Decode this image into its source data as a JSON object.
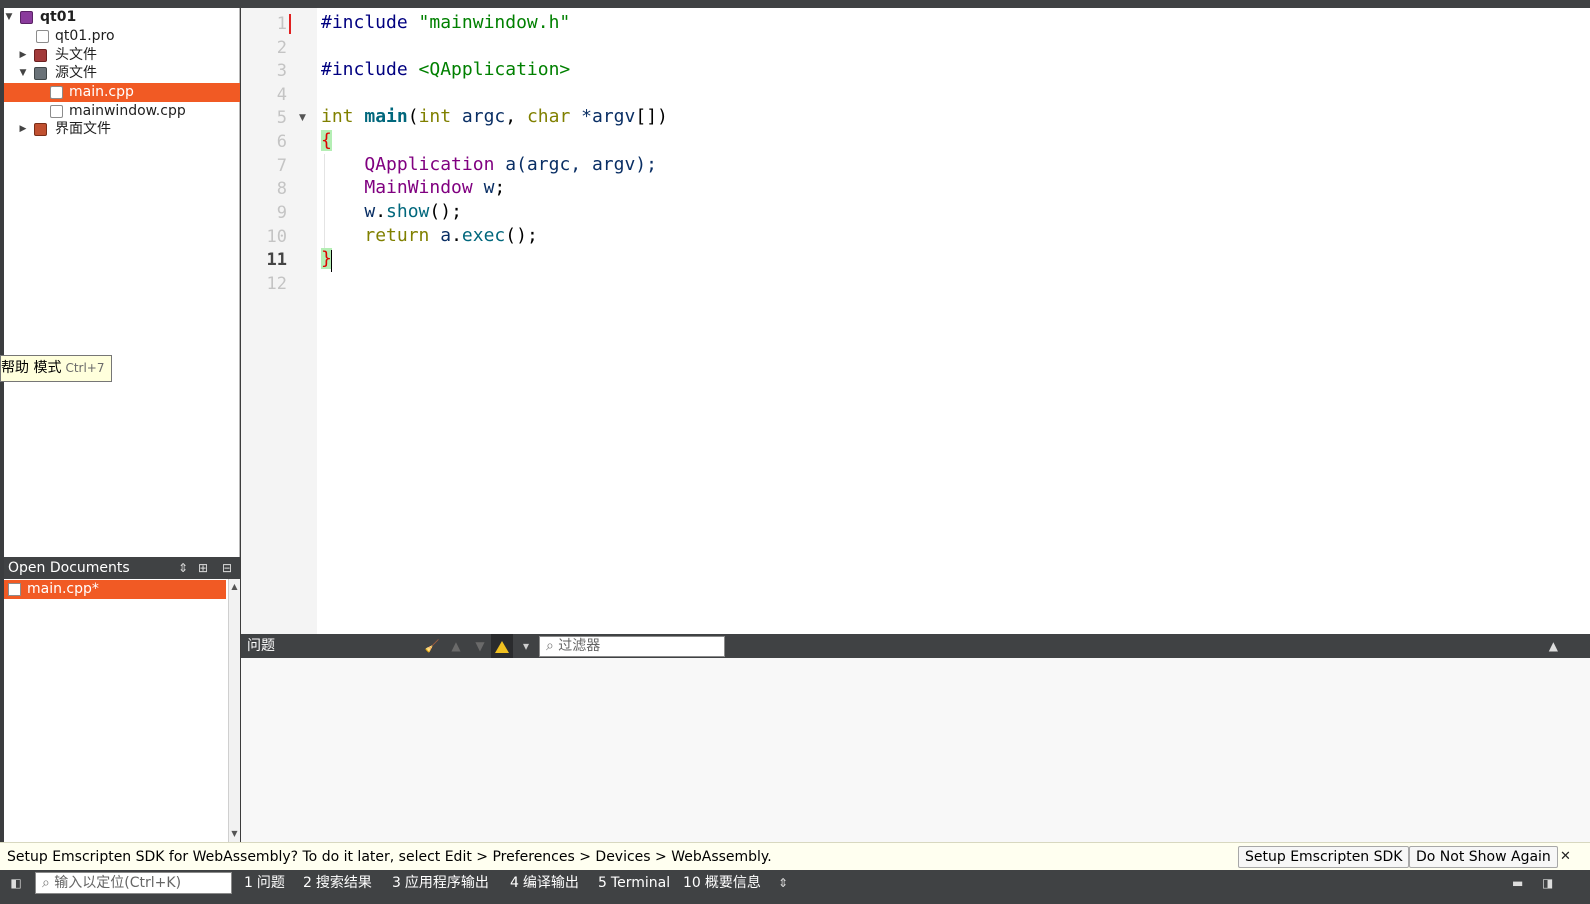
{
  "project_tree": {
    "items": [
      {
        "label": "qt01",
        "bold": true
      },
      {
        "label": "qt01.pro"
      },
      {
        "label": "头文件"
      },
      {
        "label": "源文件"
      },
      {
        "label": "main.cpp"
      },
      {
        "label": "mainwindow.cpp"
      },
      {
        "label": "界面文件"
      }
    ],
    "selected": "main.cpp"
  },
  "open_documents": {
    "title": "Open Documents",
    "items": [
      {
        "label": "main.cpp*"
      }
    ]
  },
  "editor": {
    "line_numbers": [
      "1",
      "2",
      "3",
      "4",
      "5",
      "6",
      "7",
      "8",
      "9",
      "10",
      "11",
      "12"
    ],
    "current_line": "11",
    "code": {
      "l1_directive": "#include",
      "l1_header": "\"mainwindow.h\"",
      "l3_directive": "#include",
      "l3_header": "<QApplication>",
      "l5_type": "int",
      "l5_func": "main",
      "l5_open": "(",
      "l5_argtype": "int",
      "l5_argc": "argc",
      "l5_comma": ", ",
      "l5_chartype": "char",
      "l5_argv": "*argv",
      "l5_close": "[])",
      "l6_brace": "{",
      "l7_class": "QApplication",
      "l7_rest_a": "a",
      "l7_args": "(argc, argv);",
      "l8_class": "MainWindow",
      "l8_var": "w",
      "l8_semi": ";",
      "l9_var": "w",
      "l9_dot": ".",
      "l9_call": "show",
      "l9_rest": "();",
      "l10_kw": "return",
      "l10_var": "a",
      "l10_dot": ".",
      "l10_call": "exec",
      "l10_rest": "();",
      "l11_brace": "}"
    }
  },
  "tooltip": {
    "text": "帮助 模式",
    "shortcut": "Ctrl+7"
  },
  "issues_panel": {
    "title": "问题",
    "filter_placeholder": "过滤器"
  },
  "info_bar": {
    "message": "Setup Emscripten SDK for WebAssembly? To do it later, select Edit > Preferences > Devices > WebAssembly.",
    "setup_button": "Setup Emscripten SDK",
    "dismiss_button": "Do Not Show Again"
  },
  "status_bar": {
    "locator_placeholder": "输入以定位(Ctrl+K)",
    "tabs": [
      {
        "num": "1",
        "label": "问题"
      },
      {
        "num": "2",
        "label": "搜索结果"
      },
      {
        "num": "3",
        "label": "应用程序输出"
      },
      {
        "num": "4",
        "label": "编译输出"
      },
      {
        "num": "5",
        "label": "Terminal"
      },
      {
        "num": "10",
        "label": "概要信息"
      }
    ]
  },
  "colors": {
    "selection": "#f15a24",
    "panel_dark": "#404244",
    "tooltip_bg": "#ffffdc"
  }
}
